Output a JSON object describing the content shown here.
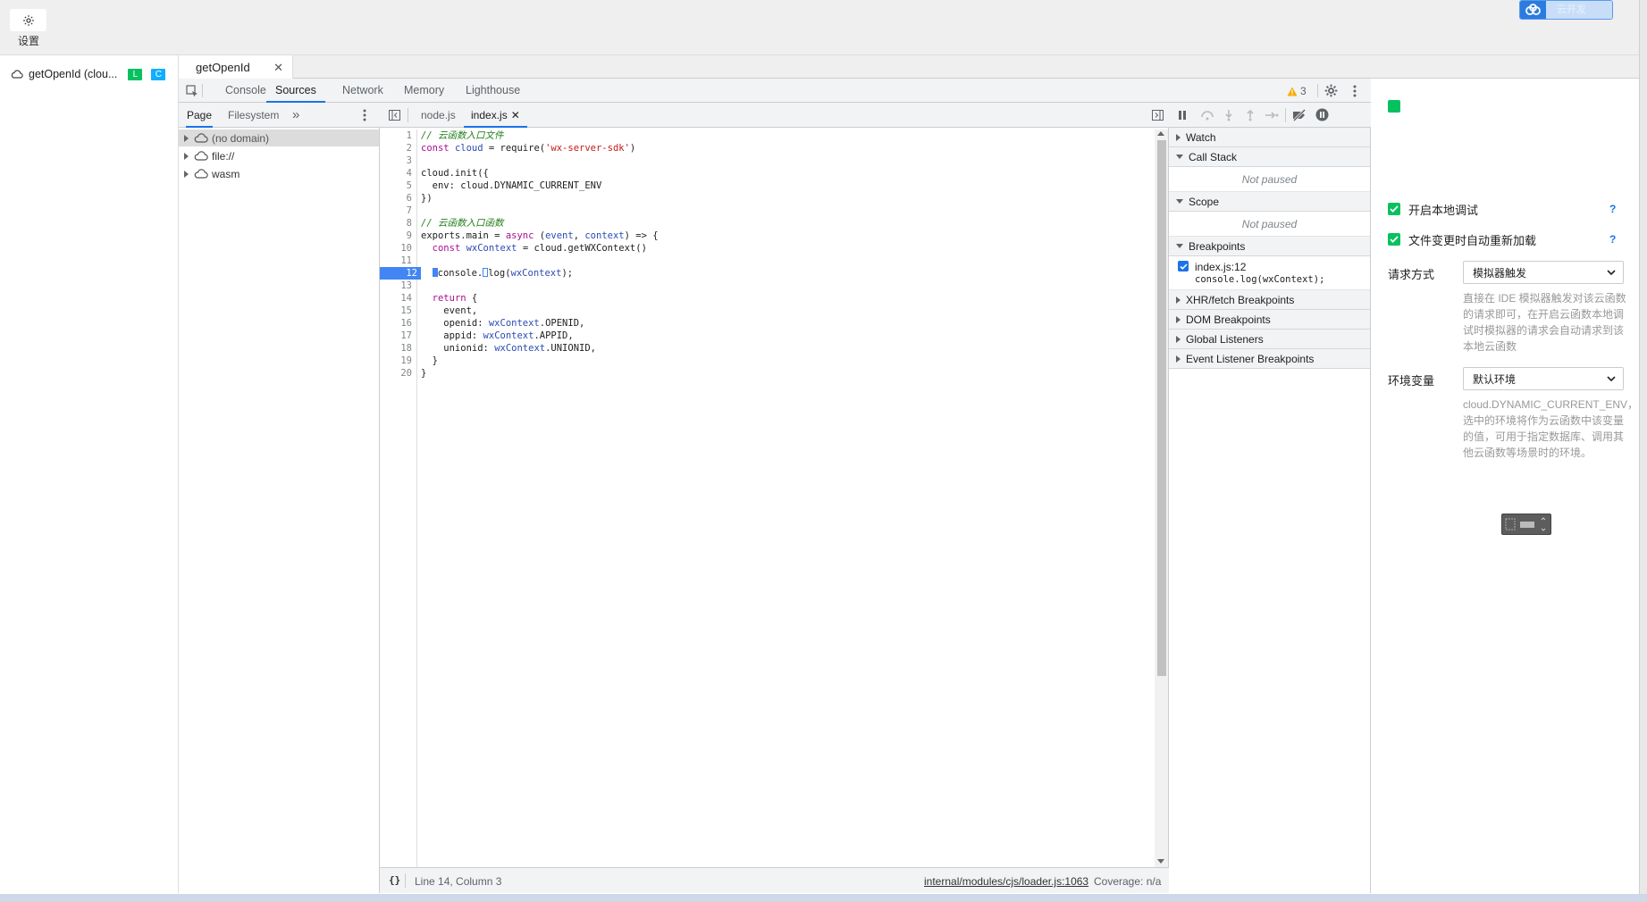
{
  "top": {
    "settings_label": "设置",
    "cloud_button_label": "云开发"
  },
  "sidebar": {
    "function_name": "getOpenId (clou...",
    "badge_l": "L",
    "badge_c": "C",
    "badge_l_color": "#07c160",
    "badge_c_color": "#10aeff"
  },
  "filetab": {
    "label": "getOpenId",
    "close": "✕"
  },
  "devtools": {
    "tabs": [
      "Console",
      "Sources",
      "Network",
      "Memory",
      "Lighthouse"
    ],
    "active_tab": "Sources",
    "warning_count": "3"
  },
  "navigator": {
    "tabs": [
      "Page",
      "Filesystem"
    ],
    "more": "»",
    "items": [
      "(no domain)",
      "file://",
      "wasm"
    ]
  },
  "editor": {
    "tabs": [
      "node.js",
      "index.js"
    ],
    "close": "✕",
    "line_numbers": [
      "1",
      "2",
      "3",
      "4",
      "5",
      "6",
      "7",
      "8",
      "9",
      "10",
      "11",
      "12",
      "13",
      "14",
      "15",
      "16",
      "17",
      "18",
      "19",
      "20"
    ],
    "breakpoint_line": "12",
    "status": {
      "format_icon": "{}",
      "position": "Line 14, Column 3",
      "source_link": "internal/modules/cjs/loader.js:1063",
      "coverage": "Coverage: n/a"
    }
  },
  "debugger": {
    "sections": {
      "watch": "Watch",
      "call_stack": "Call Stack",
      "scope": "Scope",
      "breakpoints": "Breakpoints",
      "xhr": "XHR/fetch Breakpoints",
      "dom": "DOM Breakpoints",
      "global": "Global Listeners",
      "event": "Event Listener Breakpoints"
    },
    "not_paused": "Not paused",
    "breakpoint": {
      "location": "index.js:12",
      "code": "console.log(wxContext);"
    }
  },
  "right_panel": {
    "local_debug_label": "开启本地调试",
    "auto_reload_label": "文件变更时自动重新加载",
    "help": "?",
    "request_label": "请求方式",
    "request_value": "模拟器触发",
    "request_desc": "直接在 IDE 模拟器触发对该云函数的请求即可，在开启云函数本地调试时模拟器的请求会自动请求到该本地云函数",
    "env_label": "环境变量",
    "env_value": "默认环境",
    "env_desc": "cloud.DYNAMIC_CURRENT_ENV，选中的环境将作为云函数中该变量的值，可用于指定数据库、调用其他云函数等场景时的环境。"
  }
}
